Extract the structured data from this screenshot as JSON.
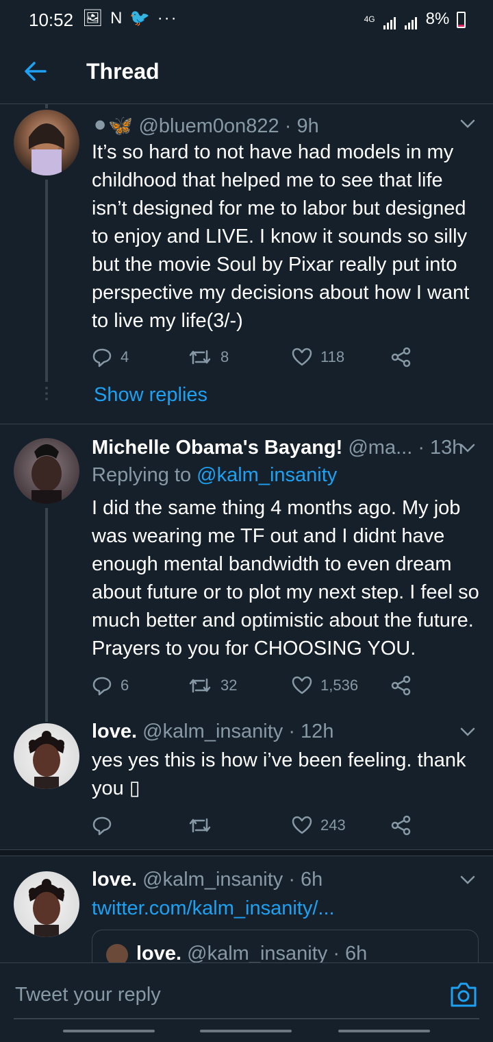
{
  "status_bar": {
    "time": "10:52",
    "notif_icons": "🖼 N 🐦 ···",
    "network": "4G",
    "battery": "8%"
  },
  "header": {
    "title": "Thread"
  },
  "tweets": [
    {
      "emoji_name": "⚫🦋",
      "handle": "@bluem0on822",
      "time": "· 9h",
      "text": "It’s so hard to not have had models in my childhood that helped me to see that life isn’t designed for me to labor but designed to enjoy and LIVE. I know it sounds so silly but the movie Soul by Pixar really put into perspective my decisions about how I want to live my life(3/-)",
      "replies": "4",
      "retweets": "8",
      "likes": "118",
      "show_replies": "Show replies"
    },
    {
      "name": "Michelle Obama's Bayang!",
      "handle": "@ma...",
      "time": "· 13h",
      "replying_prefix": "Replying to",
      "replying_handle": "@kalm_insanity",
      "text": "I did the same thing 4 months ago. My job was wearing me TF out and I didnt have enough mental bandwidth to even dream about future or to plot my next step. I feel so much better and optimistic about the future. Prayers to you for CHOOSING YOU.",
      "replies": "6",
      "retweets": "32",
      "likes": "1,536"
    },
    {
      "name": "love.",
      "handle": "@kalm_insanity",
      "time": "· 12h",
      "text": "yes yes this is how i’ve been feeling. thank you ▯",
      "replies": "",
      "retweets": "",
      "likes": "243"
    },
    {
      "name": "love.",
      "handle": "@kalm_insanity",
      "time": "· 6h",
      "link": "twitter.com/kalm_insanity/...",
      "quote": {
        "name": "love.",
        "handle": "@kalm_insanity",
        "time": "· 6h"
      }
    }
  ],
  "composer": {
    "placeholder": "Tweet your reply"
  },
  "colors": {
    "background": "#15202b",
    "accent": "#1da1f2",
    "muted": "#8899a6",
    "border": "#38444d"
  }
}
